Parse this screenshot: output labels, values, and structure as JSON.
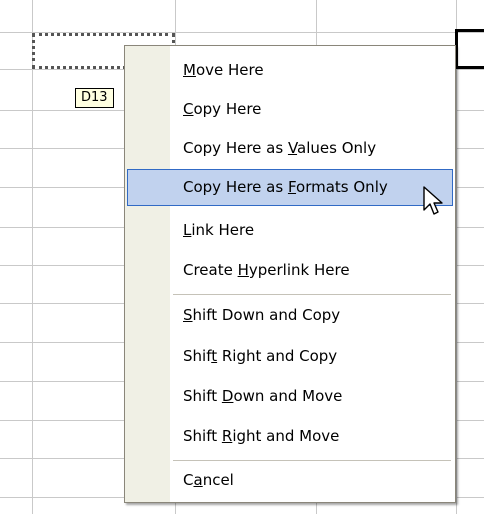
{
  "sheet": {
    "cell_reference_tip": "D13",
    "source_range_selected": true
  },
  "context_menu": {
    "items": [
      {
        "id": "move-here",
        "pre": "",
        "key": "M",
        "post": "ove Here",
        "highlighted": false
      },
      {
        "id": "copy-here",
        "pre": "",
        "key": "C",
        "post": "opy Here",
        "highlighted": false
      },
      {
        "id": "copy-here-values-only",
        "pre": "Copy Here as ",
        "key": "V",
        "post": "alues Only",
        "highlighted": false
      },
      {
        "id": "copy-here-formats-only",
        "pre": "Copy Here as ",
        "key": "F",
        "post": "ormats Only",
        "highlighted": true
      },
      {
        "id": "link-here",
        "pre": "",
        "key": "L",
        "post": "ink Here",
        "highlighted": false
      },
      {
        "id": "create-hyperlink-here",
        "pre": "Create ",
        "key": "H",
        "post": "yperlink Here",
        "highlighted": false
      },
      {
        "id": "shift-down-and-copy",
        "pre": "",
        "key": "S",
        "post": "hift Down and Copy",
        "highlighted": false
      },
      {
        "id": "shift-right-and-copy",
        "pre": "Shif",
        "key": "t",
        "post": " Right and Copy",
        "highlighted": false
      },
      {
        "id": "shift-down-and-move",
        "pre": "Shift ",
        "key": "D",
        "post": "own and Move",
        "highlighted": false
      },
      {
        "id": "shift-right-and-move",
        "pre": "Shift ",
        "key": "R",
        "post": "ight and Move",
        "highlighted": false
      },
      {
        "id": "cancel",
        "pre": "C",
        "key": "a",
        "post": "ncel",
        "highlighted": false
      }
    ]
  },
  "colors": {
    "highlight_fill": "#c1d2ee",
    "highlight_border": "#316ac5",
    "menu_gutter": "#f0f0e5",
    "tooltip_fill": "#ffffe1",
    "gridline": "#c9c9c9"
  },
  "icons": {
    "pointer": "arrow-cursor-icon"
  }
}
